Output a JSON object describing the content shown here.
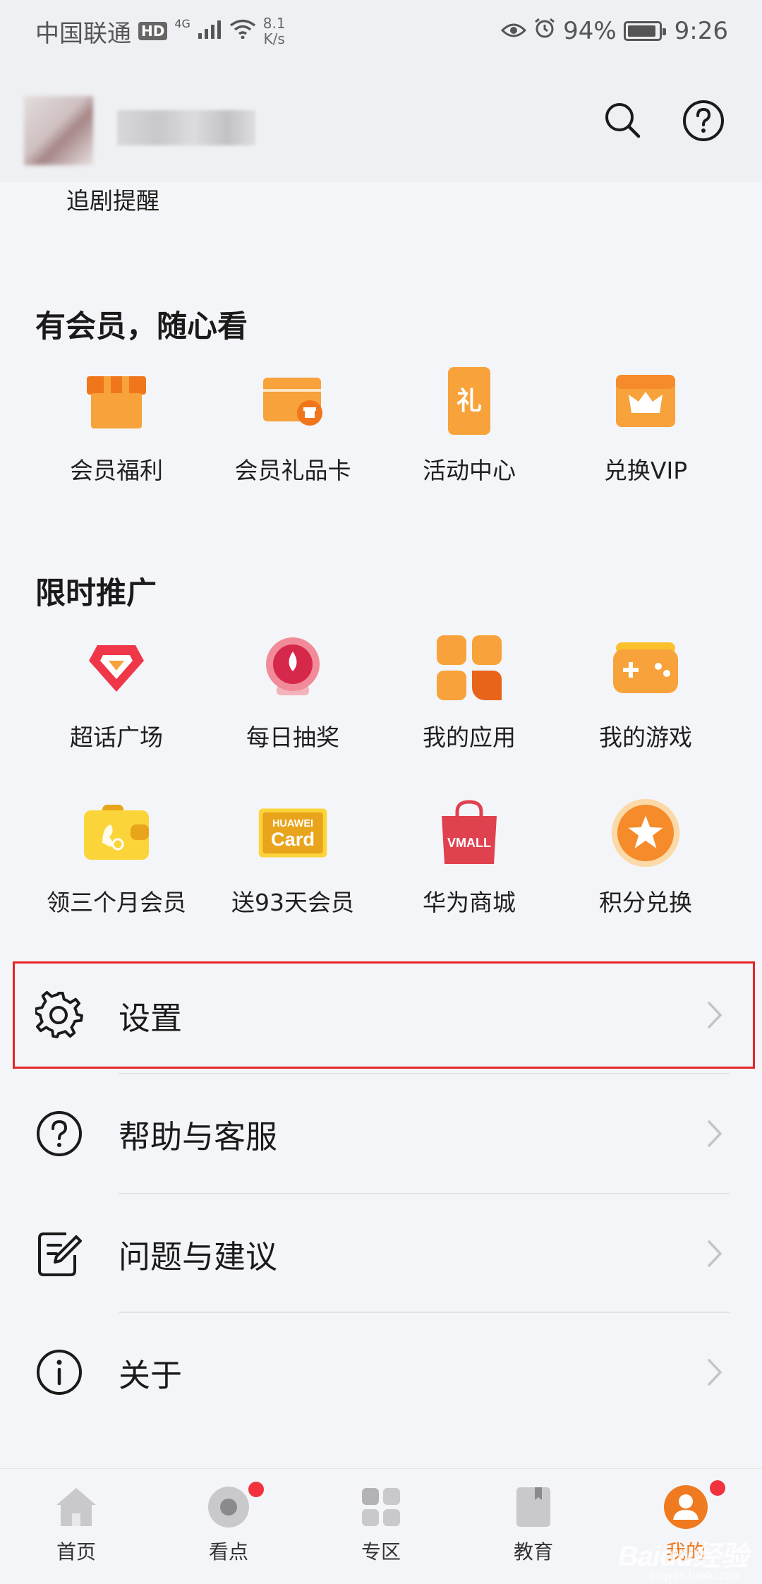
{
  "status_bar": {
    "carrier": "中国联通",
    "hd_badge": "HD",
    "signal_tag": "4G",
    "net_speed_value": "8.1",
    "net_speed_unit": "K/s",
    "battery_text": "94%",
    "battery_level": 0.94,
    "time": "9:26"
  },
  "header": {
    "search_icon": "search-icon",
    "help_icon": "help-circle-icon"
  },
  "tracker": {
    "label": "追剧提醒"
  },
  "vip_section": {
    "title": "有会员，随心看",
    "items": [
      {
        "label": "会员福利",
        "icon": "gift-icon"
      },
      {
        "label": "会员礼品卡",
        "icon": "gift-card-icon"
      },
      {
        "label": "活动中心",
        "icon": "phone-gift-icon"
      },
      {
        "label": "兑换VIP",
        "icon": "crown-icon"
      }
    ]
  },
  "promo_section": {
    "title": "限时推广",
    "items": [
      {
        "label": "超话广场",
        "icon": "diamond-icon"
      },
      {
        "label": "每日抽奖",
        "icon": "lottery-icon"
      },
      {
        "label": "我的应用",
        "icon": "apps-icon"
      },
      {
        "label": "我的游戏",
        "icon": "gamepad-icon"
      },
      {
        "label": "领三个月会员",
        "icon": "wallet-icon"
      },
      {
        "label": "送93天会员",
        "icon": "huawei-card-icon",
        "icon_text_top": "HUAWEI",
        "icon_text_main": "Card"
      },
      {
        "label": "华为商城",
        "icon": "vmall-bag-icon",
        "icon_text": "VMALL"
      },
      {
        "label": "积分兑换",
        "icon": "star-badge-icon"
      }
    ]
  },
  "menu": [
    {
      "label": "设置",
      "icon": "gear-icon"
    },
    {
      "label": "帮助与客服",
      "icon": "help-circle-icon"
    },
    {
      "label": "问题与建议",
      "icon": "feedback-edit-icon"
    },
    {
      "label": "关于",
      "icon": "info-icon"
    }
  ],
  "bottom_nav": [
    {
      "label": "首页",
      "icon": "home-icon",
      "badge": false
    },
    {
      "label": "看点",
      "icon": "discover-icon",
      "badge": true
    },
    {
      "label": "专区",
      "icon": "grid-icon",
      "badge": false
    },
    {
      "label": "教育",
      "icon": "book-icon",
      "badge": false
    },
    {
      "label": "我的",
      "icon": "profile-icon",
      "badge": true,
      "active": true
    }
  ],
  "watermark": {
    "text": "Baidu经验",
    "sub": "jingyan.baidu.com"
  },
  "colors": {
    "accent": "#f07a1f",
    "highlight": "#e5252a",
    "badge": "#f2323d"
  }
}
